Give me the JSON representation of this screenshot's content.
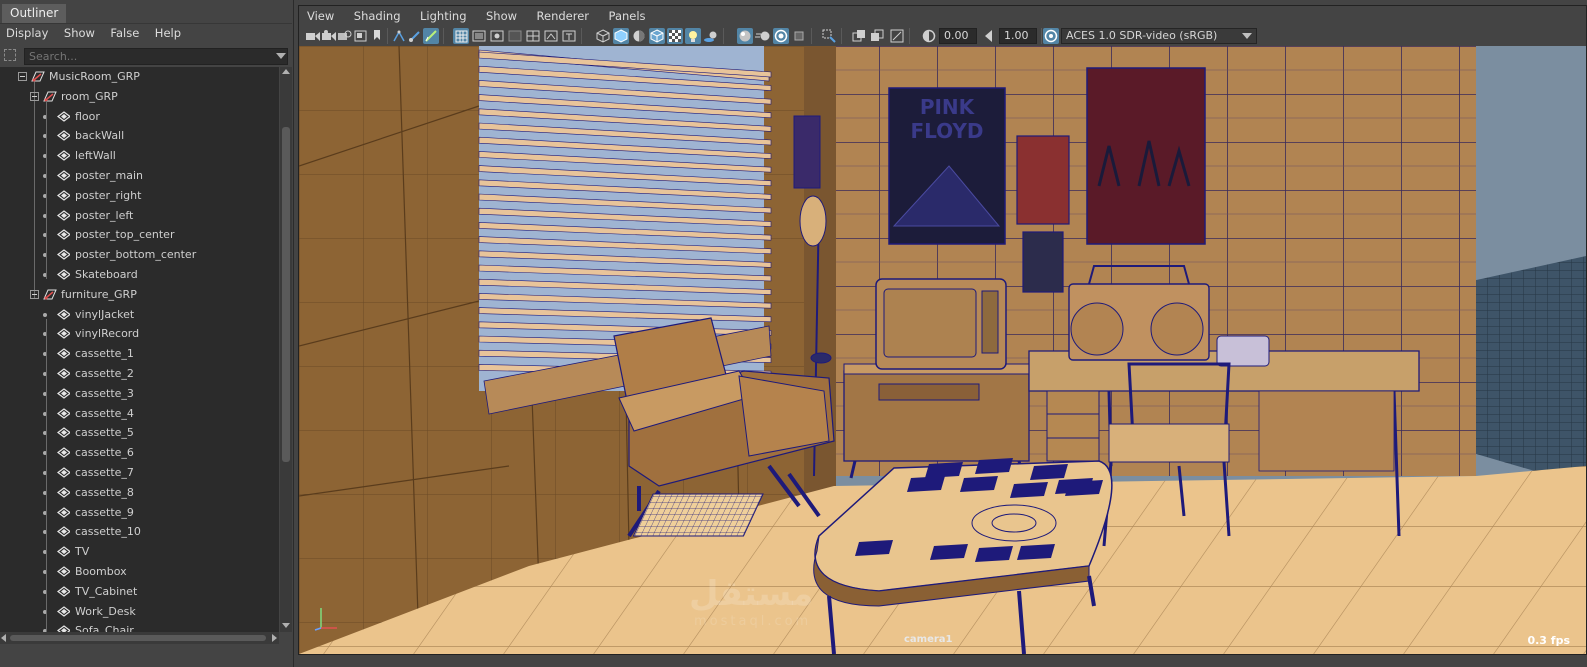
{
  "outliner": {
    "title": "Outliner",
    "menu": [
      "Display",
      "Show",
      "False",
      "Help"
    ],
    "search_placeholder": "Search...",
    "tree": [
      {
        "label": "MusicRoom_GRP",
        "kind": "group",
        "depth": 0
      },
      {
        "label": "room_GRP",
        "kind": "group",
        "depth": 1
      },
      {
        "label": "floor",
        "kind": "mesh",
        "depth": 2
      },
      {
        "label": "backWall",
        "kind": "mesh",
        "depth": 2
      },
      {
        "label": "leftWall",
        "kind": "mesh",
        "depth": 2
      },
      {
        "label": "poster_main",
        "kind": "mesh",
        "depth": 2
      },
      {
        "label": "poster_right",
        "kind": "mesh",
        "depth": 2
      },
      {
        "label": "poster_left",
        "kind": "mesh",
        "depth": 2
      },
      {
        "label": "poster_top_center",
        "kind": "mesh",
        "depth": 2
      },
      {
        "label": "poster_bottom_center",
        "kind": "mesh",
        "depth": 2
      },
      {
        "label": "Skateboard",
        "kind": "mesh",
        "depth": 2
      },
      {
        "label": "furniture_GRP",
        "kind": "group",
        "depth": 1
      },
      {
        "label": "vinylJacket",
        "kind": "mesh",
        "depth": 2
      },
      {
        "label": "vinylRecord",
        "kind": "mesh",
        "depth": 2
      },
      {
        "label": "cassette_1",
        "kind": "mesh",
        "depth": 2
      },
      {
        "label": "cassette_2",
        "kind": "mesh",
        "depth": 2
      },
      {
        "label": "cassette_3",
        "kind": "mesh",
        "depth": 2
      },
      {
        "label": "cassette_4",
        "kind": "mesh",
        "depth": 2
      },
      {
        "label": "cassette_5",
        "kind": "mesh",
        "depth": 2
      },
      {
        "label": "cassette_6",
        "kind": "mesh",
        "depth": 2
      },
      {
        "label": "cassette_7",
        "kind": "mesh",
        "depth": 2
      },
      {
        "label": "cassette_8",
        "kind": "mesh",
        "depth": 2
      },
      {
        "label": "cassette_9",
        "kind": "mesh",
        "depth": 2
      },
      {
        "label": "cassette_10",
        "kind": "mesh",
        "depth": 2
      },
      {
        "label": "TV",
        "kind": "mesh",
        "depth": 2
      },
      {
        "label": "Boombox",
        "kind": "mesh",
        "depth": 2
      },
      {
        "label": "TV_Cabinet",
        "kind": "mesh",
        "depth": 2
      },
      {
        "label": "Work_Desk",
        "kind": "mesh",
        "depth": 2
      },
      {
        "label": "Sofa_Chair",
        "kind": "mesh",
        "depth": 2
      }
    ]
  },
  "panel": {
    "menu": [
      "View",
      "Shading",
      "Lighting",
      "Show",
      "Renderer",
      "Panels"
    ],
    "exposure_value": "0.00",
    "gamma_value": "1.00",
    "color_space": "ACES 1.0 SDR-video (sRGB)"
  },
  "viewport": {
    "camera_label": "camera1",
    "fps_label": "0.3 fps",
    "poster_text_line1": "PINK",
    "poster_text_line2": "FLOYD",
    "watermark": "مستقل",
    "watermark_sub": "mostaql.com"
  },
  "colors": {
    "panel_bg": "#444444",
    "field_bg": "#2b2b2b",
    "highlight": "#5285a6",
    "wall": "#a87a48",
    "floor": "#e9c38c",
    "wire": "#1e1a7a"
  }
}
